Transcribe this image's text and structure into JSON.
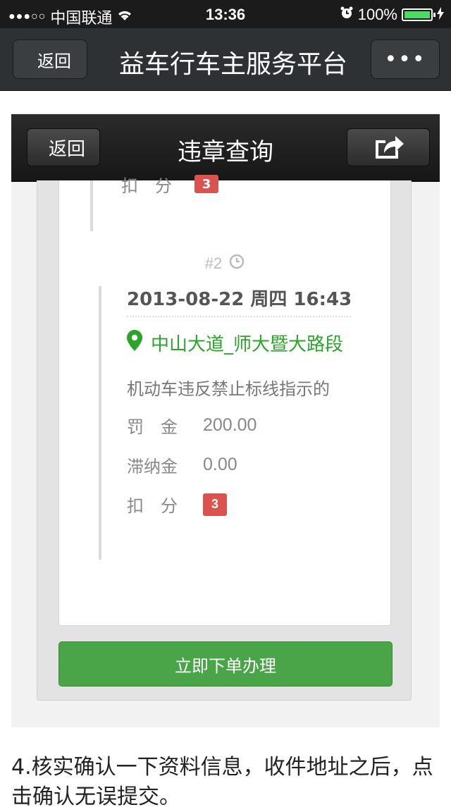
{
  "status_bar": {
    "carrier": "中国联通",
    "time": "13:36",
    "battery": "100%"
  },
  "nav": {
    "back_label": "返回",
    "title": "益车行车主服务平台",
    "more_label": "•••"
  },
  "inner_screen": {
    "back_label": "返回",
    "title": "违章查询",
    "previous_record": {
      "label": "扣　分",
      "points": "3"
    },
    "record": {
      "index": "#2",
      "datetime": "2013-08-22 周四 16:43",
      "location": "中山大道_师大暨大路段",
      "description": "机动车违反禁止标线指示的",
      "fine_label": "罚　金",
      "fine": "200.00",
      "late_fee_label": "滞纳金",
      "late_fee": "0.00",
      "points_label": "扣　分",
      "points": "3"
    },
    "order_button": "立即下单办理"
  },
  "caption": "4.核实确认一下资料信息，收件地址之后，点击确认无误提交。",
  "colors": {
    "green": "#4aa548",
    "badge_red": "#d9534f",
    "nav_dark": "#2e3133"
  }
}
